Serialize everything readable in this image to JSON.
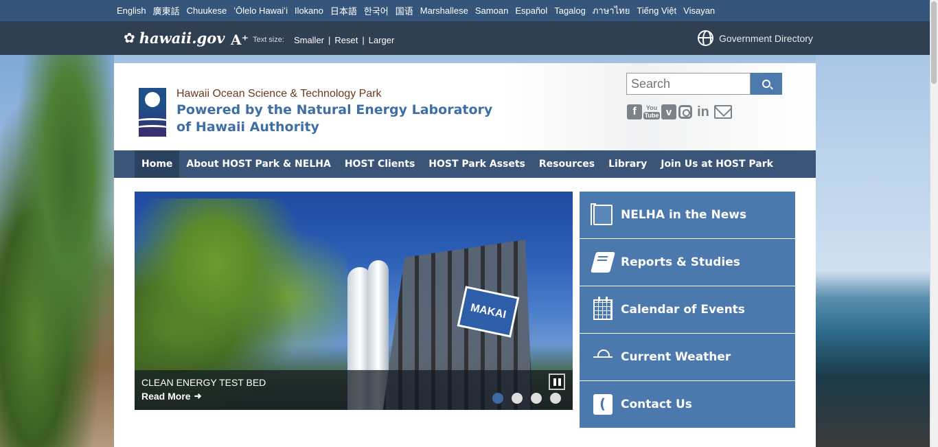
{
  "languages": [
    "English",
    "廣東話",
    "Chuukese",
    "ʻŌlelo Hawaiʻi",
    "Ilokano",
    "日本語",
    "한국어",
    "国语",
    "Marshallese",
    "Samoan",
    "Español",
    "Tagalog",
    "ภาษาไทย",
    "Tiếng Việt",
    "Visayan"
  ],
  "gov_bar": {
    "logo_text": "hawaii.gov",
    "text_size_label": "Text size:",
    "smaller": "Smaller",
    "reset": "Reset",
    "larger": "Larger",
    "separator": "|",
    "directory": "Government Directory"
  },
  "header": {
    "subtitle": "Hawaii Ocean Science & Technology Park",
    "title": "Powered by the Natural Energy Laboratory of Hawaii Authority",
    "search_placeholder": "Search"
  },
  "social": {
    "facebook": "f",
    "youtube_top": "You",
    "youtube_bottom": "Tube",
    "vimeo": "v",
    "linkedin": "in"
  },
  "nav": [
    "Home",
    "About HOST Park & NELHA",
    "HOST Clients",
    "HOST Park Assets",
    "Resources",
    "Library",
    "Join Us at HOST Park"
  ],
  "slider": {
    "sign_text": "MAKAI",
    "caption_title": "CLEAN ENERGY TEST BED",
    "read_more": "Read More",
    "read_more_icon": "➜",
    "active_dot": 0,
    "dot_count": 4
  },
  "tiles": [
    "NELHA in the News",
    "Reports & Studies",
    "Calendar of Events",
    "Current Weather",
    "Contact Us"
  ],
  "colors": {
    "lang_bar": "#35557a",
    "nav_bar": "#3a5577",
    "tile": "#4b78ad",
    "title_blue": "#3e6ea4",
    "subtitle_brown": "#6b3a1f"
  },
  "icons": {
    "flower": "✿",
    "text_size": "A⁺"
  }
}
